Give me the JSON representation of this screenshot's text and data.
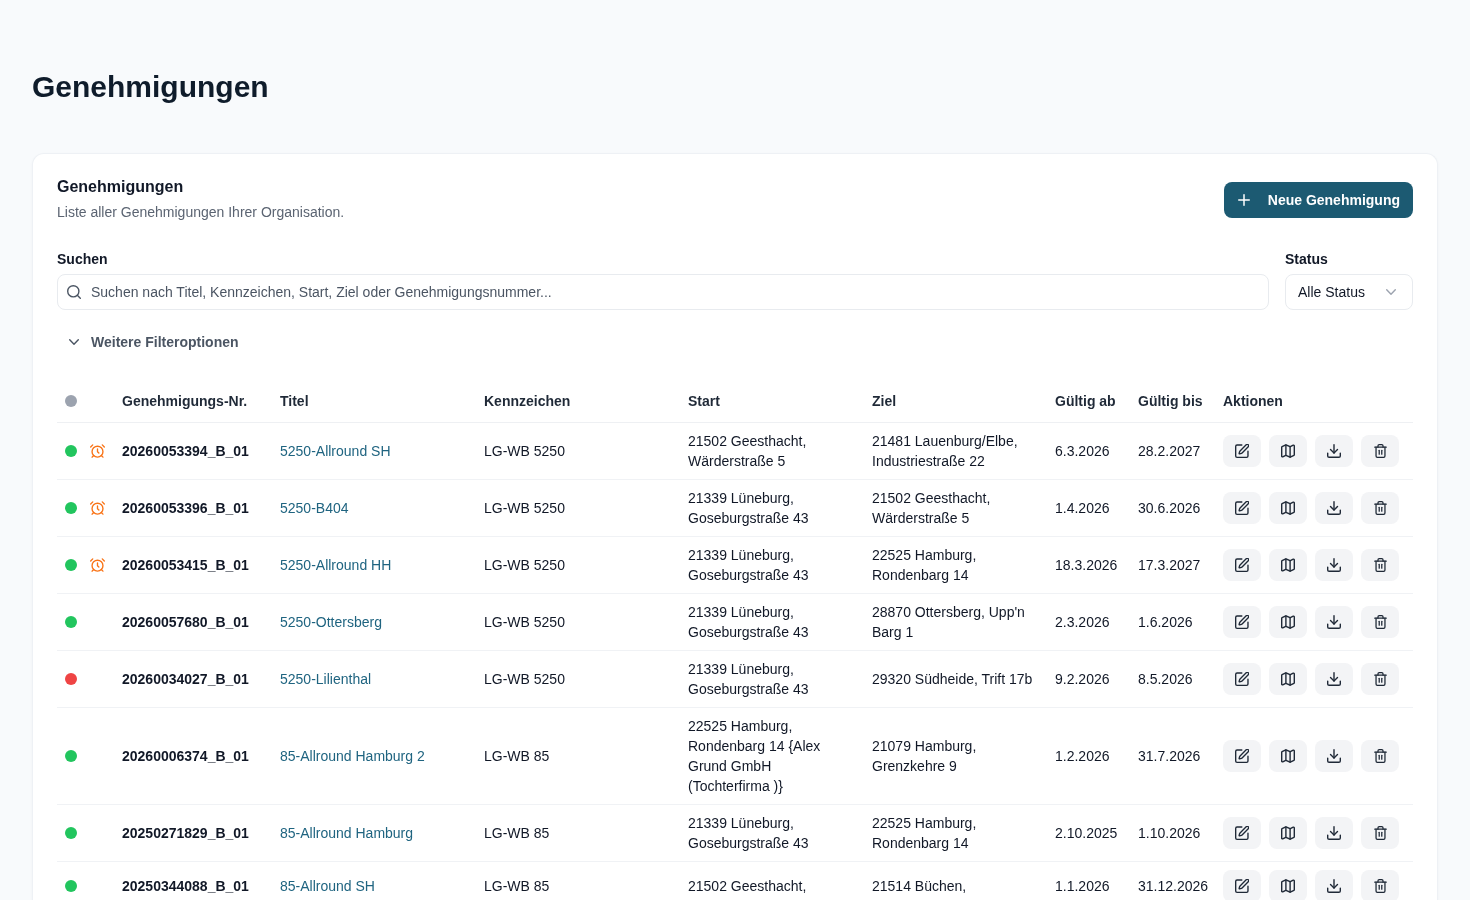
{
  "page": {
    "title": "Genehmigungen"
  },
  "card": {
    "title": "Genehmigungen",
    "subtitle": "Liste aller Genehmigungen Ihrer Organisation.",
    "new_button": "Neue Genehmigung"
  },
  "search": {
    "label": "Suchen",
    "placeholder": "Suchen nach Titel, Kennzeichen, Start, Ziel oder Genehmigungsnummer..."
  },
  "status_filter": {
    "label": "Status",
    "value": "Alle Status"
  },
  "more_filters": {
    "label": "Weitere Filteroptionen",
    "expanded": false
  },
  "table": {
    "columns": [
      "Genehmigungs-Nr.",
      "Titel",
      "Kennzeichen",
      "Start",
      "Ziel",
      "Gültig ab",
      "Gültig bis",
      "Aktionen"
    ],
    "rows": [
      {
        "color": "#22c55e",
        "reminder": true,
        "number": "20260053394_B_01",
        "title": "5250-Allround SH",
        "plate": "LG-WB 5250",
        "start": "21502 Geesthacht, Wärderstraße 5",
        "destination": "21481 Lauenburg/Elbe, Industriestraße 22",
        "valid_from": "6.3.2026",
        "valid_to": "28.2.2027"
      },
      {
        "color": "#22c55e",
        "reminder": true,
        "number": "20260053396_B_01",
        "title": "5250-B404",
        "plate": "LG-WB 5250",
        "start": "21339 Lüneburg, Goseburgstraße 43",
        "destination": "21502 Geesthacht, Wärderstraße 5",
        "valid_from": "1.4.2026",
        "valid_to": "30.6.2026"
      },
      {
        "color": "#22c55e",
        "reminder": true,
        "number": "20260053415_B_01",
        "title": "5250-Allround HH",
        "plate": "LG-WB 5250",
        "start": "21339 Lüneburg, Goseburgstraße 43",
        "destination": "22525 Hamburg, Rondenbarg 14",
        "valid_from": "18.3.2026",
        "valid_to": "17.3.2027"
      },
      {
        "color": "#22c55e",
        "reminder": false,
        "number": "20260057680_B_01",
        "title": "5250-Ottersberg",
        "plate": "LG-WB 5250",
        "start": "21339 Lüneburg, Goseburgstraße 43",
        "destination": "28870 Ottersberg, Upp'n Barg 1",
        "valid_from": "2.3.2026",
        "valid_to": "1.6.2026"
      },
      {
        "color": "#ef4444",
        "reminder": false,
        "number": "20260034027_B_01",
        "title": "5250-Lilienthal",
        "plate": "LG-WB 5250",
        "start": "21339 Lüneburg, Goseburgstraße 43",
        "destination": "29320 Südheide, Trift 17b",
        "valid_from": "9.2.2026",
        "valid_to": "8.5.2026"
      },
      {
        "color": "#22c55e",
        "reminder": false,
        "number": "20260006374_B_01",
        "title": "85-Allround Hamburg 2",
        "plate": "LG-WB 85",
        "start": "22525 Hamburg, Rondenbarg 14 {Alex Grund GmbH (Tochterfirma )}",
        "destination": "21079 Hamburg, Grenzkehre 9",
        "valid_from": "1.2.2026",
        "valid_to": "31.7.2026"
      },
      {
        "color": "#22c55e",
        "reminder": false,
        "number": "20250271829_B_01",
        "title": "85-Allround Hamburg",
        "plate": "LG-WB 85",
        "start": "21339 Lüneburg, Goseburgstraße 43",
        "destination": "22525 Hamburg, Rondenbarg 14",
        "valid_from": "2.10.2025",
        "valid_to": "1.10.2026"
      },
      {
        "color": "#22c55e",
        "reminder": false,
        "number": "20250344088_B_01",
        "title": "85-Allround SH",
        "plate": "LG-WB 85",
        "start": "21502 Geesthacht,",
        "destination": "21514 Büchen,",
        "valid_from": "1.1.2026",
        "valid_to": "31.12.2026"
      }
    ]
  }
}
